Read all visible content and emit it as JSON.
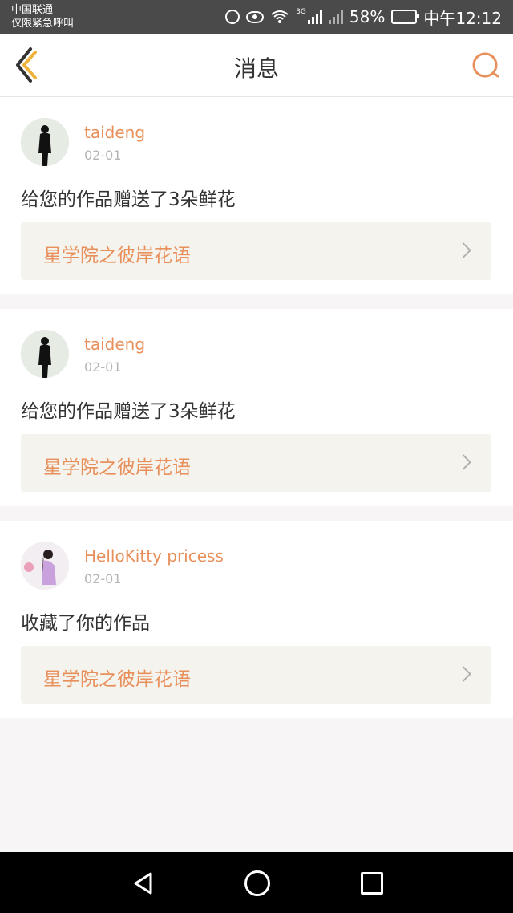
{
  "status_bar": {
    "carrier_line1": "中国联通",
    "carrier_line2": "仅限紧急呼叫",
    "network_tag": "3G",
    "battery": "58%",
    "time": "中午12:12"
  },
  "header": {
    "title": "消息",
    "back_icon": "chevron-left-icon",
    "search_icon": "search-icon",
    "accent_color": "#e8905c"
  },
  "messages": [
    {
      "username": "taideng",
      "date": "02-01",
      "text": "给您的作品赠送了3朵鲜花",
      "work_title": "星学院之彼岸花语"
    },
    {
      "username": "taideng",
      "date": "02-01",
      "text": "给您的作品赠送了3朵鲜花",
      "work_title": "星学院之彼岸花语"
    },
    {
      "username": "HelloKitty pricess",
      "date": "02-01",
      "text": "收藏了你的作品",
      "work_title": "星学院之彼岸花语"
    }
  ],
  "nav_bar": {
    "back_icon": "triangle-back-icon",
    "home_icon": "circle-home-icon",
    "recent_icon": "square-recent-icon"
  }
}
